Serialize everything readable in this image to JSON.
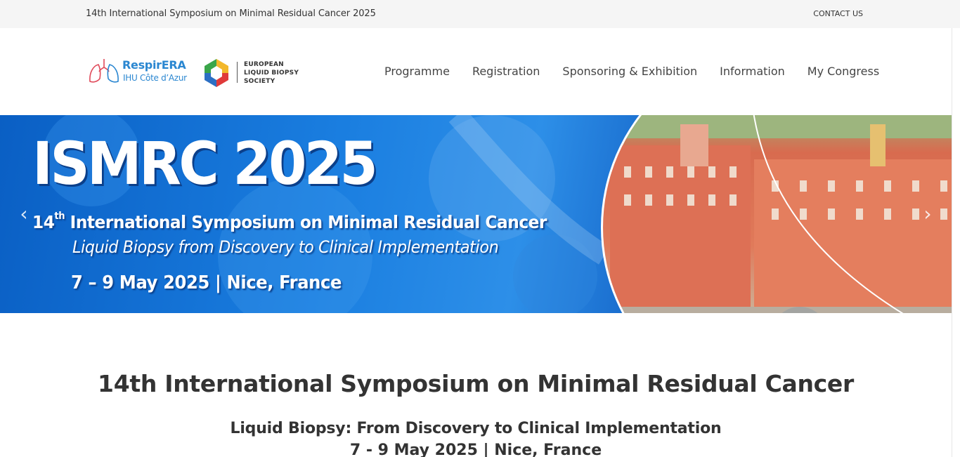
{
  "topbar": {
    "title": "14th International Symposium on Minimal Residual Cancer 2025",
    "contact": "CONTACT US"
  },
  "logos": {
    "respirera_name": "RespirERA",
    "respirera_sub": "IHU Côte d’Azur",
    "elbs_line1": "EUROPEAN",
    "elbs_line2": "LIQUID BIOPSY",
    "elbs_line3": "SOCIETY"
  },
  "nav": {
    "items": [
      "Programme",
      "Registration",
      "Sponsoring & Exhibition",
      "Information",
      "My Congress"
    ]
  },
  "banner": {
    "title": "ISMRC 2025",
    "line1_num": "14",
    "line1_sup": "th",
    "line1_rest": " International Symposium on Minimal Residual Cancer",
    "line2": "Liquid Biopsy from Discovery to Clinical Implementation",
    "line3": "7 – 9 May 2025 | Nice, France",
    "prev": "‹",
    "next": "›"
  },
  "content": {
    "title": "14th International Symposium on Minimal Residual Cancer",
    "subtitle": "Liquid Biopsy: From Discovery to Clinical Implementation",
    "date": "7 - 9 May 2025 | Nice, France"
  },
  "colors": {
    "accent_blue": "#2b87d1",
    "banner_blue": "#1a7ee0",
    "topbar_bg": "#f5f5f5"
  }
}
